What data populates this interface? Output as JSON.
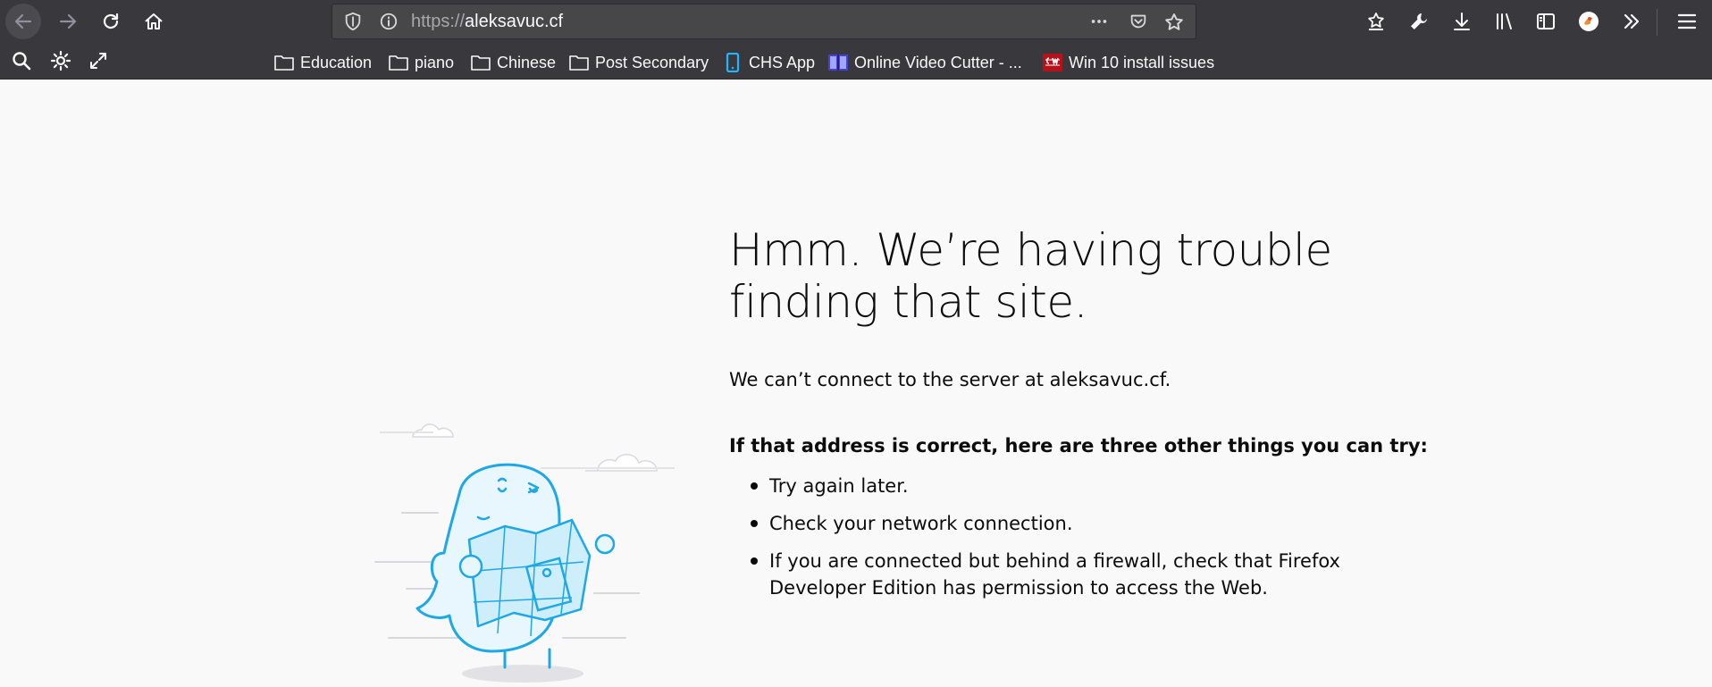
{
  "browser": {
    "url_protocol": "https://",
    "url_host": "aleksavuc.cf",
    "bookmarks": [
      {
        "label": "Education",
        "icon": "folder-icon"
      },
      {
        "label": "piano",
        "icon": "folder-icon"
      },
      {
        "label": "Chinese",
        "icon": "folder-icon"
      },
      {
        "label": "Post Secondary",
        "icon": "folder-icon"
      },
      {
        "label": "CHS App",
        "icon": "phone-icon"
      },
      {
        "label": "Online Video Cutter - ...",
        "icon": "video-cutter-icon"
      },
      {
        "label": "Win 10 install issues",
        "icon": "cw-icon"
      }
    ]
  },
  "error_page": {
    "title": "Hmm. We’re having trouble finding that site.",
    "description": "We can’t connect to the server at aleksavuc.cf.",
    "subheading": "If that address is correct, here are three other things you can try:",
    "tips": [
      "Try again later.",
      "Check your network connection.",
      "If you are connected but behind a firewall, check that Firefox Developer Edition has permission to access the Web."
    ]
  },
  "colors": {
    "toolbar_bg": "#38383d",
    "page_bg": "#f9f9fa",
    "illustration_blue": "#1ea8e7"
  }
}
